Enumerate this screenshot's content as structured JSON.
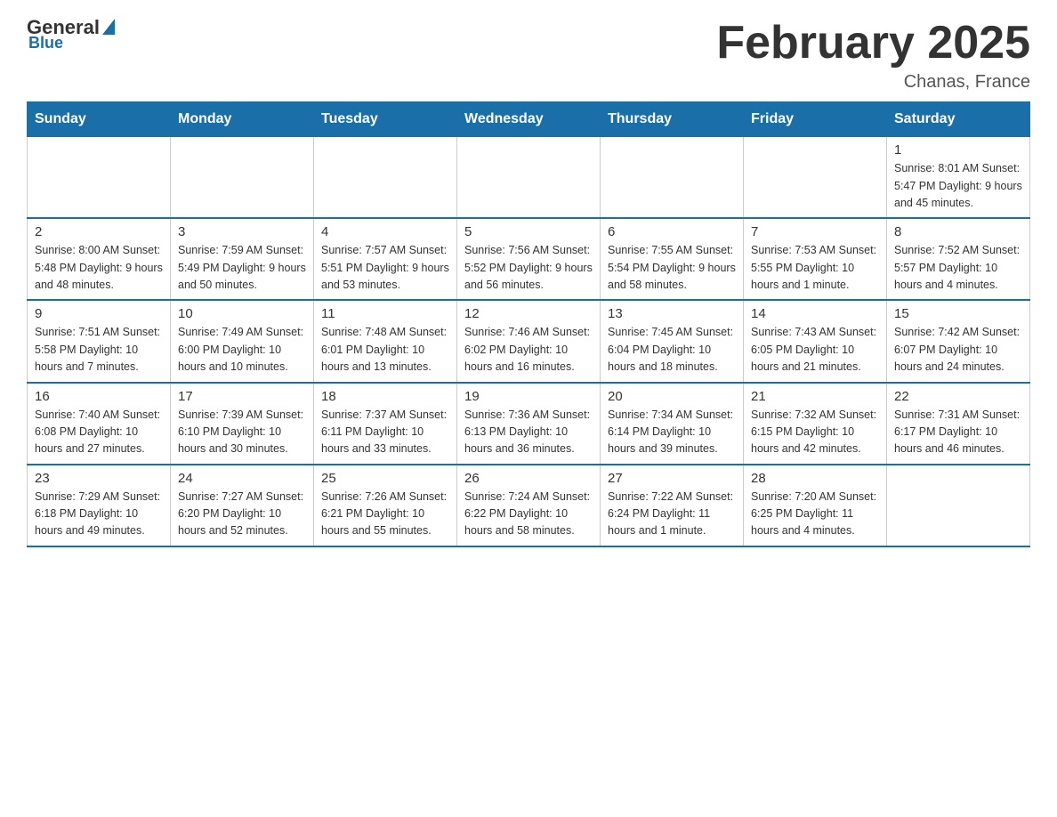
{
  "header": {
    "logo_general": "General",
    "logo_blue": "Blue",
    "month_title": "February 2025",
    "location": "Chanas, France"
  },
  "days_of_week": [
    "Sunday",
    "Monday",
    "Tuesday",
    "Wednesday",
    "Thursday",
    "Friday",
    "Saturday"
  ],
  "weeks": [
    [
      {
        "day": "",
        "info": ""
      },
      {
        "day": "",
        "info": ""
      },
      {
        "day": "",
        "info": ""
      },
      {
        "day": "",
        "info": ""
      },
      {
        "day": "",
        "info": ""
      },
      {
        "day": "",
        "info": ""
      },
      {
        "day": "1",
        "info": "Sunrise: 8:01 AM\nSunset: 5:47 PM\nDaylight: 9 hours\nand 45 minutes."
      }
    ],
    [
      {
        "day": "2",
        "info": "Sunrise: 8:00 AM\nSunset: 5:48 PM\nDaylight: 9 hours\nand 48 minutes."
      },
      {
        "day": "3",
        "info": "Sunrise: 7:59 AM\nSunset: 5:49 PM\nDaylight: 9 hours\nand 50 minutes."
      },
      {
        "day": "4",
        "info": "Sunrise: 7:57 AM\nSunset: 5:51 PM\nDaylight: 9 hours\nand 53 minutes."
      },
      {
        "day": "5",
        "info": "Sunrise: 7:56 AM\nSunset: 5:52 PM\nDaylight: 9 hours\nand 56 minutes."
      },
      {
        "day": "6",
        "info": "Sunrise: 7:55 AM\nSunset: 5:54 PM\nDaylight: 9 hours\nand 58 minutes."
      },
      {
        "day": "7",
        "info": "Sunrise: 7:53 AM\nSunset: 5:55 PM\nDaylight: 10 hours\nand 1 minute."
      },
      {
        "day": "8",
        "info": "Sunrise: 7:52 AM\nSunset: 5:57 PM\nDaylight: 10 hours\nand 4 minutes."
      }
    ],
    [
      {
        "day": "9",
        "info": "Sunrise: 7:51 AM\nSunset: 5:58 PM\nDaylight: 10 hours\nand 7 minutes."
      },
      {
        "day": "10",
        "info": "Sunrise: 7:49 AM\nSunset: 6:00 PM\nDaylight: 10 hours\nand 10 minutes."
      },
      {
        "day": "11",
        "info": "Sunrise: 7:48 AM\nSunset: 6:01 PM\nDaylight: 10 hours\nand 13 minutes."
      },
      {
        "day": "12",
        "info": "Sunrise: 7:46 AM\nSunset: 6:02 PM\nDaylight: 10 hours\nand 16 minutes."
      },
      {
        "day": "13",
        "info": "Sunrise: 7:45 AM\nSunset: 6:04 PM\nDaylight: 10 hours\nand 18 minutes."
      },
      {
        "day": "14",
        "info": "Sunrise: 7:43 AM\nSunset: 6:05 PM\nDaylight: 10 hours\nand 21 minutes."
      },
      {
        "day": "15",
        "info": "Sunrise: 7:42 AM\nSunset: 6:07 PM\nDaylight: 10 hours\nand 24 minutes."
      }
    ],
    [
      {
        "day": "16",
        "info": "Sunrise: 7:40 AM\nSunset: 6:08 PM\nDaylight: 10 hours\nand 27 minutes."
      },
      {
        "day": "17",
        "info": "Sunrise: 7:39 AM\nSunset: 6:10 PM\nDaylight: 10 hours\nand 30 minutes."
      },
      {
        "day": "18",
        "info": "Sunrise: 7:37 AM\nSunset: 6:11 PM\nDaylight: 10 hours\nand 33 minutes."
      },
      {
        "day": "19",
        "info": "Sunrise: 7:36 AM\nSunset: 6:13 PM\nDaylight: 10 hours\nand 36 minutes."
      },
      {
        "day": "20",
        "info": "Sunrise: 7:34 AM\nSunset: 6:14 PM\nDaylight: 10 hours\nand 39 minutes."
      },
      {
        "day": "21",
        "info": "Sunrise: 7:32 AM\nSunset: 6:15 PM\nDaylight: 10 hours\nand 42 minutes."
      },
      {
        "day": "22",
        "info": "Sunrise: 7:31 AM\nSunset: 6:17 PM\nDaylight: 10 hours\nand 46 minutes."
      }
    ],
    [
      {
        "day": "23",
        "info": "Sunrise: 7:29 AM\nSunset: 6:18 PM\nDaylight: 10 hours\nand 49 minutes."
      },
      {
        "day": "24",
        "info": "Sunrise: 7:27 AM\nSunset: 6:20 PM\nDaylight: 10 hours\nand 52 minutes."
      },
      {
        "day": "25",
        "info": "Sunrise: 7:26 AM\nSunset: 6:21 PM\nDaylight: 10 hours\nand 55 minutes."
      },
      {
        "day": "26",
        "info": "Sunrise: 7:24 AM\nSunset: 6:22 PM\nDaylight: 10 hours\nand 58 minutes."
      },
      {
        "day": "27",
        "info": "Sunrise: 7:22 AM\nSunset: 6:24 PM\nDaylight: 11 hours\nand 1 minute."
      },
      {
        "day": "28",
        "info": "Sunrise: 7:20 AM\nSunset: 6:25 PM\nDaylight: 11 hours\nand 4 minutes."
      },
      {
        "day": "",
        "info": ""
      }
    ]
  ]
}
